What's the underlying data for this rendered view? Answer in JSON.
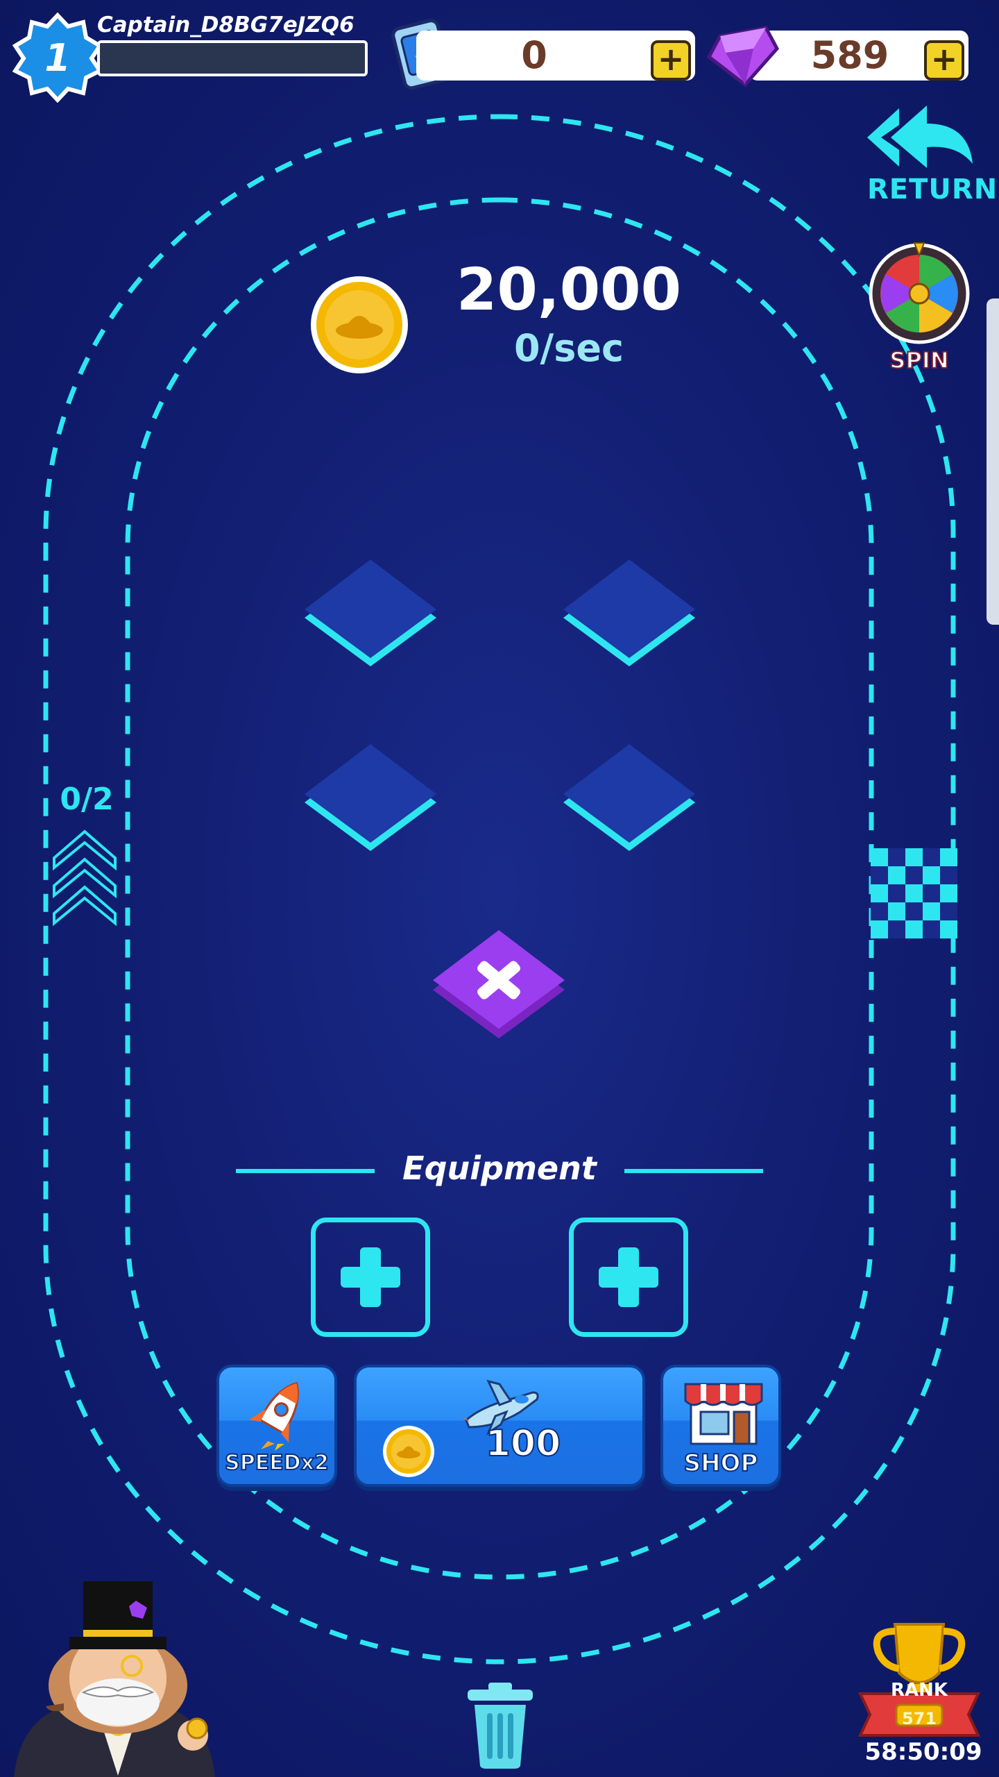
{
  "player": {
    "level": "1",
    "name": "Captain_D8BG7eJZQ6",
    "xp_progress": 0
  },
  "currency": {
    "tickets": "0",
    "gems": "589",
    "add_symbol": "+"
  },
  "nav": {
    "return_label": "RETURN",
    "spin_label": "SPIN"
  },
  "coins": {
    "total": "20,000",
    "rate": "0/sec"
  },
  "track": {
    "lap_counter": "0/2"
  },
  "equipment": {
    "title": "Equipment"
  },
  "actions": {
    "speed_label": "SPEEDx2",
    "buy_price": "100",
    "shop_label": "SHOP"
  },
  "rank": {
    "label": "RANK",
    "number": "571",
    "timer": "58:50:09"
  },
  "colors": {
    "background": "#121f73",
    "accent_cyan": "#2ee6f0",
    "tile_blue": "#1d3aa6",
    "delete_purple": "#9b3ef0",
    "coin_gold": "#f5b800",
    "gem_purple": "#b44cf0",
    "button_blue": "#2a8cf5"
  },
  "icons": {
    "level": "blue-star-badge-icon",
    "ticket": "ticket-card-icon",
    "gem": "purple-gem-icon",
    "return": "double-back-arrow-icon",
    "spin": "prize-wheel-icon",
    "coin": "ufo-coin-icon",
    "delete": "x-icon",
    "speed": "rocket-icon",
    "buy": "jet-plane-icon",
    "shop": "storefront-icon",
    "trash": "trash-can-icon",
    "rank": "trophy-icon",
    "flag": "checkered-flag-icon",
    "mascot": "tycoon-mascot-icon"
  }
}
